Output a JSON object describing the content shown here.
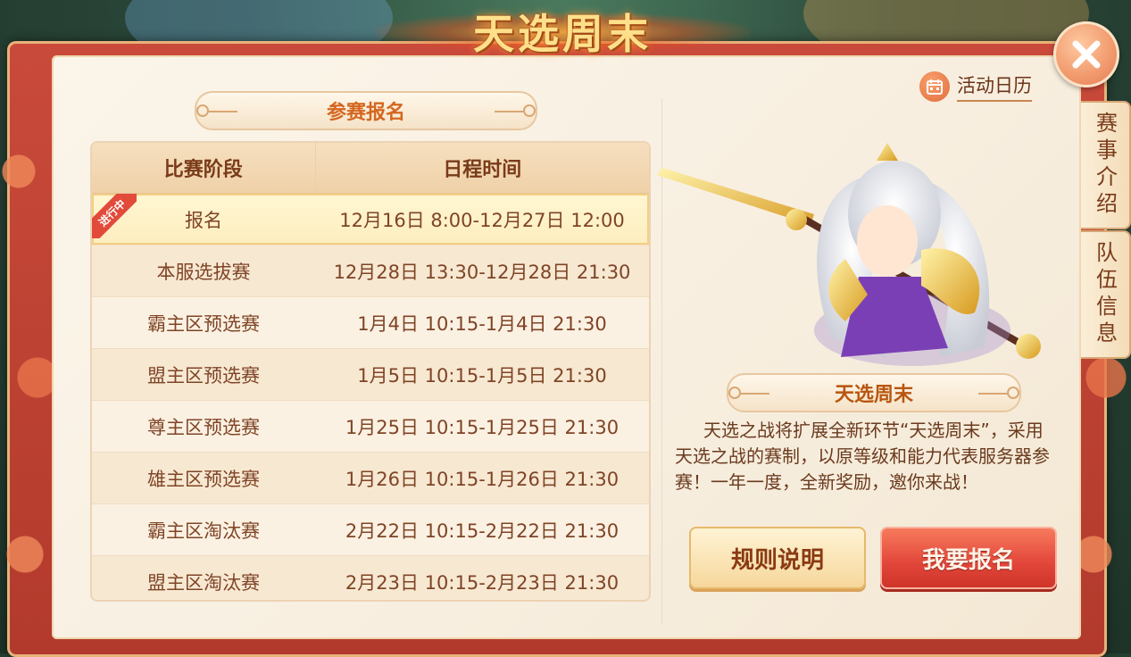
{
  "title": "天选周末",
  "close_icon": "close-icon",
  "side_tabs": [
    "赛事介绍",
    "队伍信息"
  ],
  "calendar": {
    "icon": "calendar-icon",
    "label": "活动日历"
  },
  "signup_section": {
    "title": "参赛报名",
    "headers": [
      "比赛阶段",
      "日程时间"
    ],
    "active_badge": "进行中",
    "rows": [
      {
        "stage": "报名",
        "time": "12月16日 8:00-12月27日 12:00",
        "active": true
      },
      {
        "stage": "本服选拔赛",
        "time": "12月28日 13:30-12月28日 21:30"
      },
      {
        "stage": "霸主区预选赛",
        "time": "1月4日 10:15-1月4日 21:30"
      },
      {
        "stage": "盟主区预选赛",
        "time": "1月5日 10:15-1月5日 21:30"
      },
      {
        "stage": "尊主区预选赛",
        "time": "1月25日 10:15-1月25日 21:30"
      },
      {
        "stage": "雄主区预选赛",
        "time": "1月26日 10:15-1月26日 21:30"
      },
      {
        "stage": "霸主区淘汰赛",
        "time": "2月22日 10:15-2月22日 21:30"
      },
      {
        "stage": "盟主区淘汰赛",
        "time": "2月23日 10:15-2月23日 21:30"
      }
    ]
  },
  "event_info": {
    "title": "天选周末",
    "description": "天选之战将扩展全新环节“天选周末”，采用天选之战的赛制，以原等级和能力代表服务器参赛！一年一度，全新奖励，邀你来战！"
  },
  "buttons": {
    "rules": "规则说明",
    "signup": "我要报名"
  },
  "colors": {
    "frame": "#c94a3a",
    "accent": "#d4661f",
    "signup_button": "#e2463a",
    "active_badge": "#e24a3a"
  }
}
